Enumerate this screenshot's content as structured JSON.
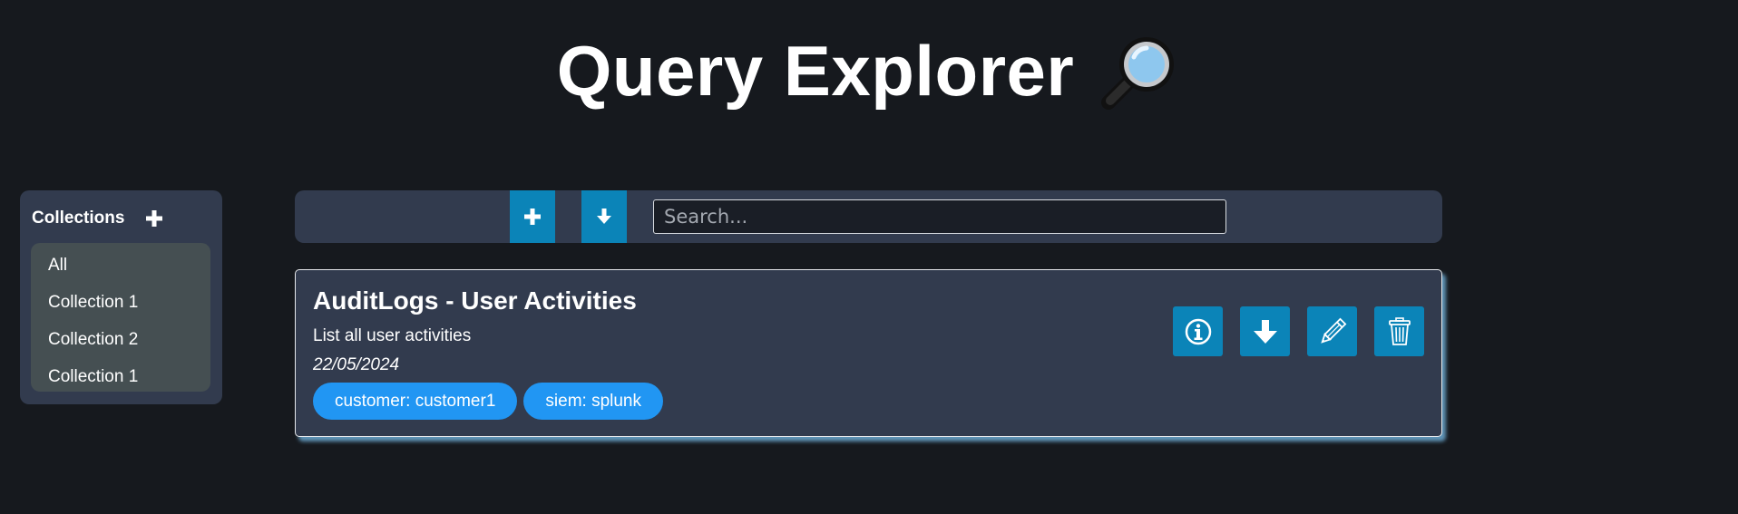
{
  "header": {
    "title": "Query Explorer",
    "title_icon": "magnifying-glass-icon"
  },
  "sidebar": {
    "title": "Collections",
    "add_icon": "plus-icon",
    "items": [
      {
        "label": "All"
      },
      {
        "label": "Collection 1"
      },
      {
        "label": "Collection 2"
      },
      {
        "label": "Collection 1"
      }
    ]
  },
  "toolbar": {
    "add_icon": "plus-icon",
    "download_icon": "download-arrow-icon",
    "search_placeholder": "Search...",
    "search_value": ""
  },
  "queries": [
    {
      "title": "AuditLogs - User Activities",
      "description": "List all user activities",
      "date": "22/05/2024",
      "tags": [
        {
          "label": "customer: customer1"
        },
        {
          "label": "siem: splunk"
        }
      ],
      "actions": [
        "info-icon",
        "download-arrow-icon",
        "pencil-icon",
        "trash-icon"
      ]
    }
  ],
  "colors": {
    "background": "#16191e",
    "panel": "#323b4e",
    "collection_list_bg": "#454f52",
    "button": "#0b84b8",
    "tag": "#2196f3",
    "card_glow": "#78beeb"
  }
}
